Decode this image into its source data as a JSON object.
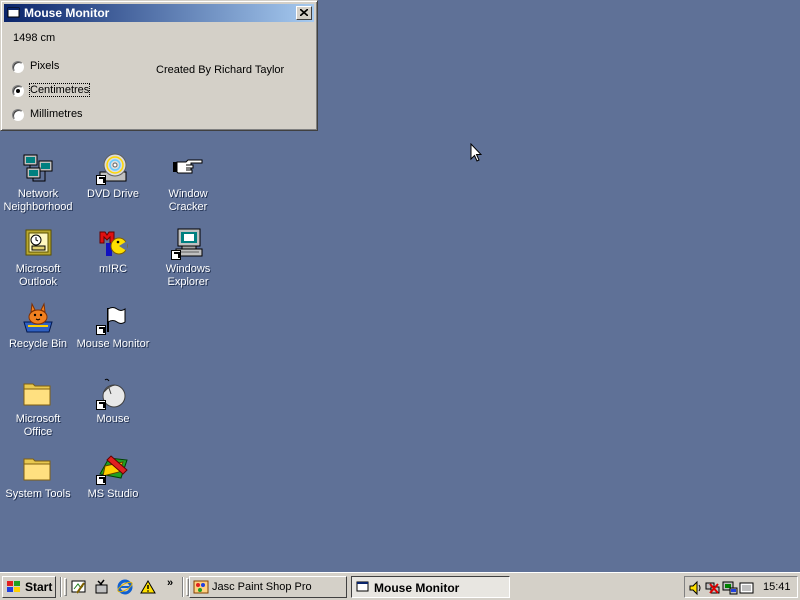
{
  "window": {
    "title": "Mouse Monitor",
    "distance": "1498 cm",
    "units": [
      {
        "label": "Pixels",
        "checked": false
      },
      {
        "label": "Centimetres",
        "checked": true
      },
      {
        "label": "Millimetres",
        "checked": false
      }
    ],
    "credit": "Created By Richard Taylor"
  },
  "desktop": {
    "background_color": "#5f7197",
    "icons": [
      {
        "label": "Network Neighborhood",
        "icon": "network-icon"
      },
      {
        "label": "DVD Drive",
        "icon": "dvd-drive-icon"
      },
      {
        "label": "Window Cracker",
        "icon": "pointing-hand-icon"
      },
      {
        "label": "Microsoft Outlook",
        "icon": "outlook-icon"
      },
      {
        "label": "mIRC",
        "icon": "mirc-icon"
      },
      {
        "label": "Windows Explorer",
        "icon": "explorer-icon"
      },
      {
        "label": "Recycle Bin",
        "icon": "recycle-bin-icon"
      },
      {
        "label": "Mouse Monitor",
        "icon": "flag-icon"
      },
      {
        "label": "Microsoft Office",
        "icon": "folder-icon"
      },
      {
        "label": "Mouse",
        "icon": "mouse-icon"
      },
      {
        "label": "System Tools",
        "icon": "folder-icon"
      },
      {
        "label": "MS Studio",
        "icon": "ms-studio-icon"
      }
    ]
  },
  "taskbar": {
    "start_label": "Start",
    "quick_launch": [
      "show-desktop-icon",
      "tools-icon",
      "internet-explorer-icon",
      "warning-icon"
    ],
    "tasks": [
      {
        "label": "Jasc Paint Shop Pro",
        "active": false
      },
      {
        "label": "Mouse Monitor",
        "active": true
      }
    ],
    "tray_icons": [
      "volume-icon",
      "network-disconnected-icon",
      "display-icon",
      "task-scheduler-icon"
    ],
    "clock": "15:41"
  }
}
